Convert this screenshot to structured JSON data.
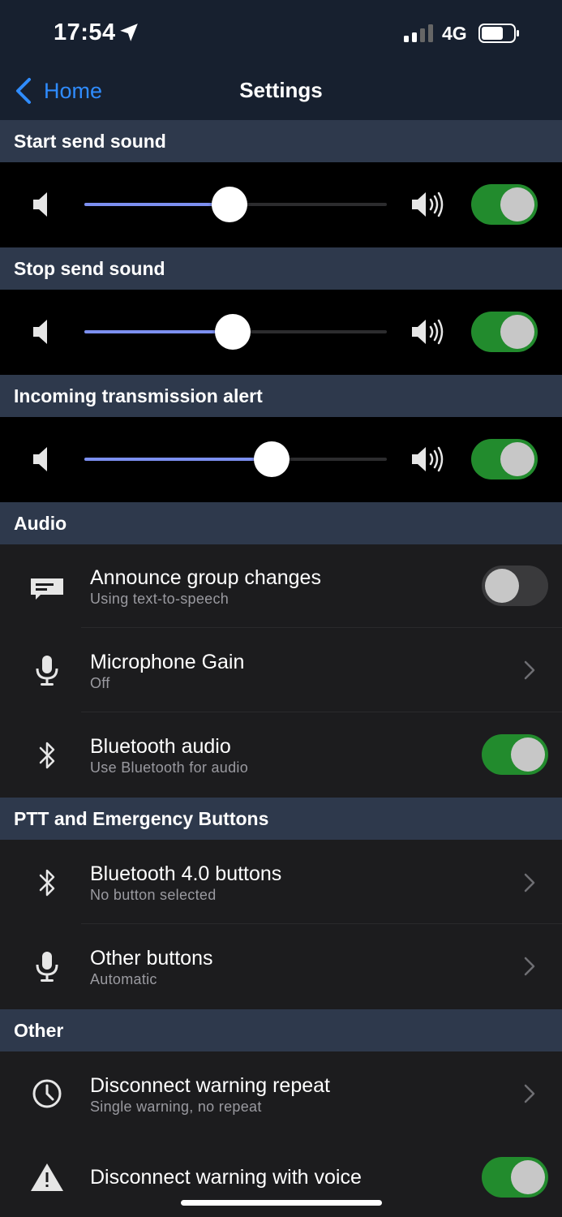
{
  "status": {
    "time": "17:54",
    "network": "4G"
  },
  "nav": {
    "back_label": "Home",
    "title": "Settings"
  },
  "sounds": [
    {
      "header": "Start send sound",
      "volume_percent": 48,
      "enabled": true
    },
    {
      "header": "Stop send sound",
      "volume_percent": 49,
      "enabled": true
    },
    {
      "header": "Incoming transmission alert",
      "volume_percent": 62,
      "enabled": true
    }
  ],
  "audio": {
    "header": "Audio",
    "items": [
      {
        "title": "Announce group changes",
        "subtitle": "Using text-to-speech",
        "icon": "message-icon",
        "control": "toggle",
        "enabled": false
      },
      {
        "title": "Microphone Gain",
        "subtitle": "Off",
        "icon": "microphone-icon",
        "control": "chevron"
      },
      {
        "title": "Bluetooth audio",
        "subtitle": "Use Bluetooth for audio",
        "icon": "bluetooth-icon",
        "control": "toggle",
        "enabled": true
      }
    ]
  },
  "ptt": {
    "header": "PTT and Emergency Buttons",
    "items": [
      {
        "title": "Bluetooth 4.0 buttons",
        "subtitle": "No button selected",
        "icon": "bluetooth-icon",
        "control": "chevron"
      },
      {
        "title": "Other buttons",
        "subtitle": "Automatic",
        "icon": "microphone-icon",
        "control": "chevron"
      }
    ]
  },
  "other": {
    "header": "Other",
    "items": [
      {
        "title": "Disconnect warning repeat",
        "subtitle": "Single warning, no repeat",
        "icon": "clock-icon",
        "control": "chevron"
      },
      {
        "title": "Disconnect warning with voice",
        "icon": "warning-icon",
        "control": "toggle",
        "enabled": true
      }
    ]
  },
  "colors": {
    "accent": "#2f8cff",
    "toggle_on": "#228b2d",
    "slider_fill": "#7c8ff0",
    "header_bg": "#2e394c"
  }
}
